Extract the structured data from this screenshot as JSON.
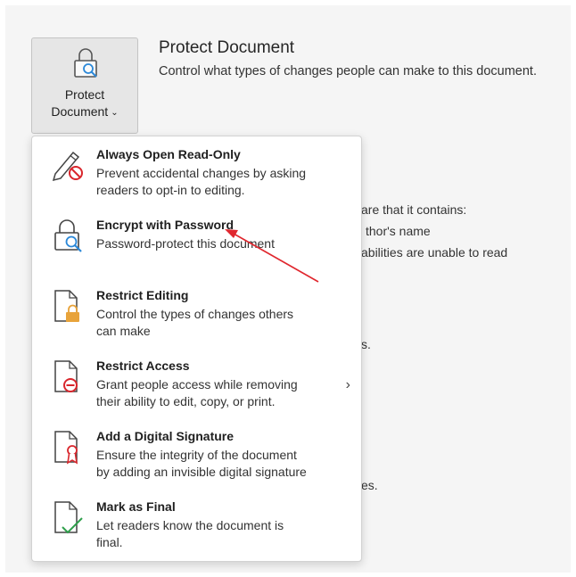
{
  "protect_button": {
    "line1": "Protect",
    "line2": "Document",
    "icon": "lock-document-icon"
  },
  "header": {
    "title": "Protect Document",
    "subtitle": "Control what types of changes people can make to this document."
  },
  "background_text": [
    "are that it contains:",
    "thor's name",
    "abilities are unable to read",
    "s.",
    "es."
  ],
  "menu": {
    "items": [
      {
        "name": "Always Open Read-Only",
        "desc": [
          "Prevent accidental changes by asking",
          "readers to opt-in to editing."
        ],
        "icon": "pencil-prohibited-icon"
      },
      {
        "name": "Encrypt with Password",
        "desc": [
          "Password-protect this document"
        ],
        "icon": "lock-key-icon"
      },
      {
        "name": "Restrict Editing",
        "desc": [
          "Control the types of changes others",
          "can make"
        ],
        "icon": "document-lock-icon"
      },
      {
        "name": "Restrict Access",
        "desc": [
          "Grant people access while removing",
          "their ability to edit, copy, or print."
        ],
        "icon": "document-restrict-icon",
        "submenu_chevron": "›"
      },
      {
        "name": "Add a Digital Signature",
        "desc": [
          "Ensure the integrity of the document",
          "by adding an invisible digital signature"
        ],
        "icon": "document-ribbon-icon"
      },
      {
        "name": "Mark as Final",
        "desc": [
          "Let readers know the document is",
          "final."
        ],
        "icon": "document-checkmark-icon"
      }
    ]
  },
  "colors": {
    "accent_red": "#d9262c",
    "lock_gold": "#e8a33a",
    "key_blue": "#2b88d8",
    "checkmark_green": "#2e9f4b",
    "annotation_arrow": "#e0272e"
  }
}
